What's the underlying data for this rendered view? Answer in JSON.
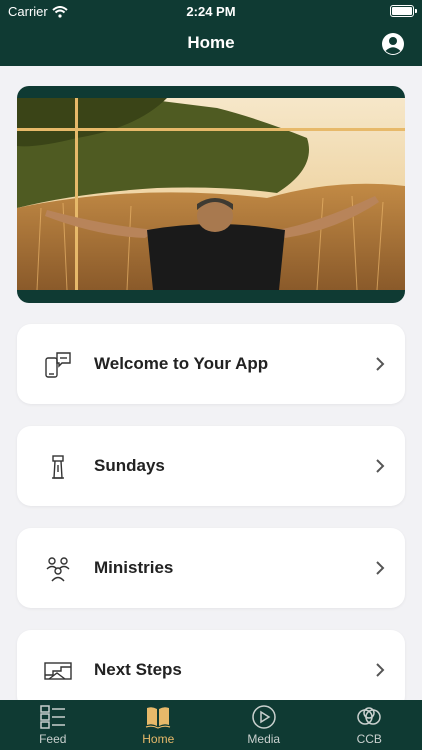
{
  "status_bar": {
    "carrier": "Carrier",
    "time": "2:24 PM"
  },
  "nav": {
    "title": "Home"
  },
  "menu": [
    {
      "label": "Welcome to Your App",
      "icon": "phone-chat-icon"
    },
    {
      "label": "Sundays",
      "icon": "podium-icon"
    },
    {
      "label": "Ministries",
      "icon": "people-group-icon"
    },
    {
      "label": "Next Steps",
      "icon": "steps-icon"
    }
  ],
  "tabs": [
    {
      "label": "Feed",
      "icon": "feed-icon",
      "active": false
    },
    {
      "label": "Home",
      "icon": "book-icon",
      "active": true
    },
    {
      "label": "Media",
      "icon": "play-icon",
      "active": false
    },
    {
      "label": "CCB",
      "icon": "circles-icon",
      "active": false
    }
  ],
  "colors": {
    "brand": "#0f3a33",
    "accent": "#e7b96a",
    "background": "#f2f2f5"
  }
}
